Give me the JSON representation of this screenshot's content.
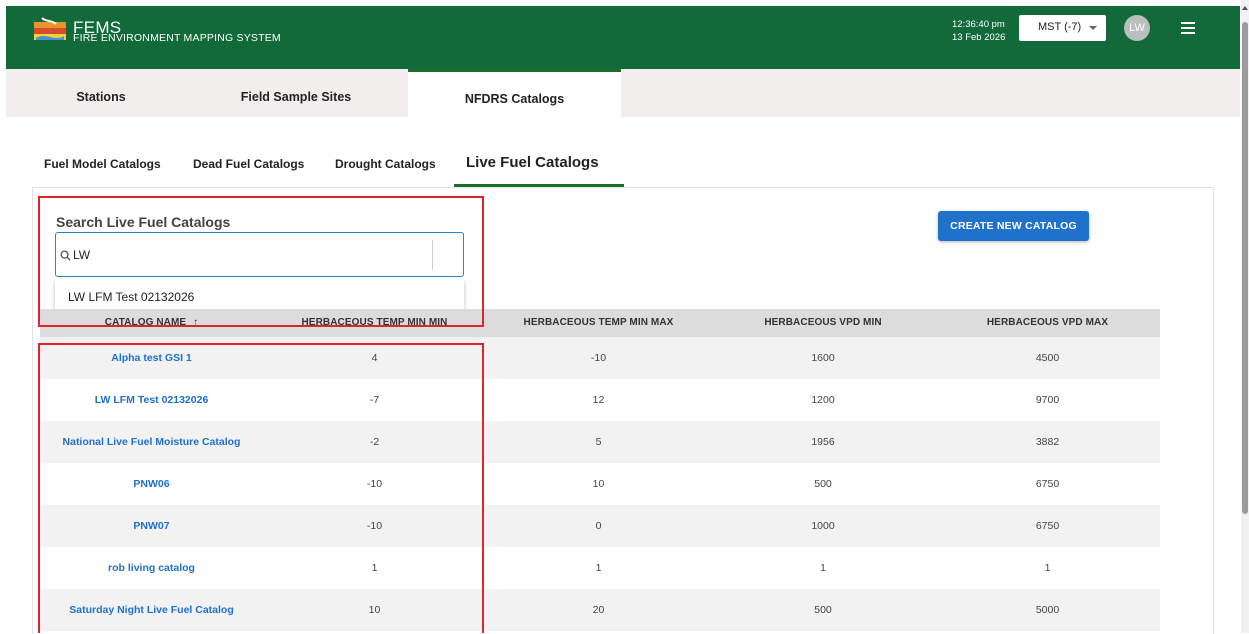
{
  "header": {
    "brand_title": "FEMS",
    "brand_subtitle": "FIRE ENVIRONMENT MAPPING SYSTEM",
    "time": "12:36:40 pm",
    "date": "13 Feb 2026",
    "timezone": "MST (-7)",
    "avatar_initials": "LW",
    "colors": {
      "header_bg": "#126a3b",
      "accent": "#1f71c9",
      "tab_accent": "#1b6d2a"
    }
  },
  "tabs": [
    {
      "label": "Stations"
    },
    {
      "label": "Field Sample Sites"
    },
    {
      "label": "NFDRS Catalogs",
      "active": true
    }
  ],
  "subtabs": [
    {
      "label": "Fuel Model Catalogs"
    },
    {
      "label": "Dead Fuel Catalogs"
    },
    {
      "label": "Drought Catalogs"
    },
    {
      "label": "Live Fuel Catalogs",
      "active": true
    }
  ],
  "search": {
    "label": "Search Live Fuel Catalogs",
    "value": "LW",
    "suggestion": "LW LFM Test 02132026"
  },
  "create_button": "CREATE NEW CATALOG",
  "table": {
    "columns": [
      "CATALOG NAME",
      "HERBACEOUS TEMP MIN MIN",
      "HERBACEOUS TEMP MIN MAX",
      "HERBACEOUS VPD MIN",
      "HERBACEOUS VPD MAX"
    ],
    "sort_indicator": "↑",
    "rows": [
      [
        "Alpha test GSI 1",
        "4",
        "-10",
        "1600",
        "4500"
      ],
      [
        "LW LFM Test 02132026",
        "-7",
        "12",
        "1200",
        "9700"
      ],
      [
        "National Live Fuel Moisture Catalog",
        "-2",
        "5",
        "1956",
        "3882"
      ],
      [
        "PNW06",
        "-10",
        "10",
        "500",
        "6750"
      ],
      [
        "PNW07",
        "-10",
        "0",
        "1000",
        "6750"
      ],
      [
        "rob living catalog",
        "1",
        "1",
        "1",
        "1"
      ],
      [
        "Saturday Night Live Fuel Catalog",
        "10",
        "20",
        "500",
        "5000"
      ]
    ]
  }
}
